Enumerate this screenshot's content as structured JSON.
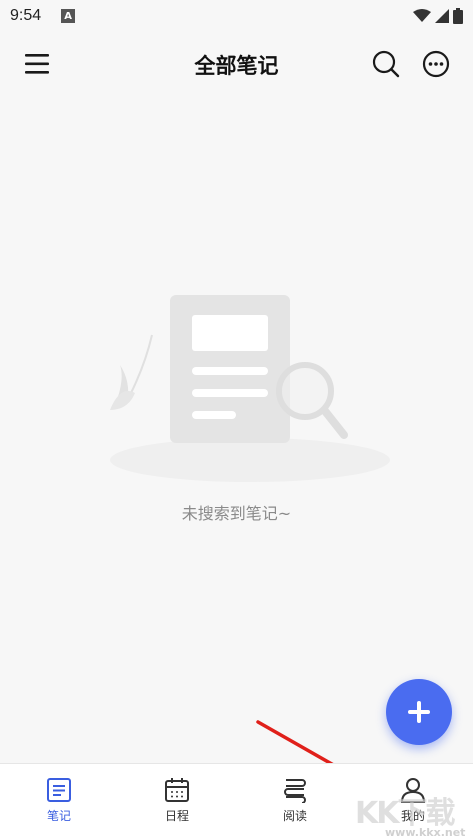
{
  "status_bar": {
    "time": "9:54",
    "notification_letter": "A"
  },
  "header": {
    "title": "全部笔记"
  },
  "empty_state": {
    "message": "未搜索到笔记~"
  },
  "fab": {
    "label": "+"
  },
  "tabs": [
    {
      "label": "笔记",
      "icon": "note-icon",
      "active": true
    },
    {
      "label": "日程",
      "icon": "calendar-icon",
      "active": false
    },
    {
      "label": "阅读",
      "icon": "book-icon",
      "active": false
    },
    {
      "label": "我的",
      "icon": "profile-icon",
      "active": false
    }
  ],
  "watermark": {
    "text": "KK下载",
    "url": "www.kkx.net"
  },
  "colors": {
    "accent": "#4a6cf0",
    "active_tab": "#3a5ee0",
    "annotation_arrow": "#e0201a"
  }
}
